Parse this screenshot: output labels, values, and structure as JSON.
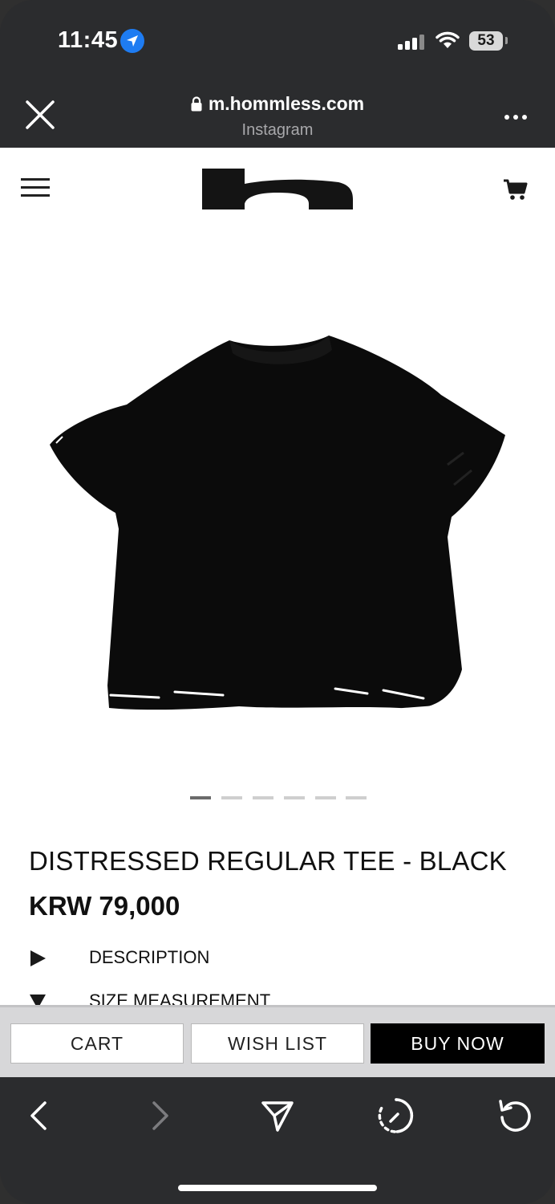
{
  "status_bar": {
    "time": "11:45",
    "battery": "53"
  },
  "browser": {
    "domain": "m.hommless.com",
    "source": "Instagram"
  },
  "product": {
    "title": "DISTRESSED REGULAR TEE - BLACK",
    "price": "KRW 79,000",
    "image_count": 6,
    "active_image": 1,
    "sections": [
      {
        "label": "DESCRIPTION",
        "state": "collapsed"
      },
      {
        "label": "SIZE MEASUREMENT",
        "state": "expanded"
      }
    ]
  },
  "actions": {
    "cart": "CART",
    "wishlist": "WISH LIST",
    "buy_now": "BUY NOW"
  },
  "icons": [
    "location-arrow-icon",
    "signal-icon",
    "wifi-icon",
    "battery-icon",
    "close-icon",
    "lock-icon",
    "more-icon",
    "menu-icon",
    "cart-icon",
    "back-icon",
    "forward-icon",
    "share-icon",
    "history-icon",
    "reload-icon"
  ]
}
